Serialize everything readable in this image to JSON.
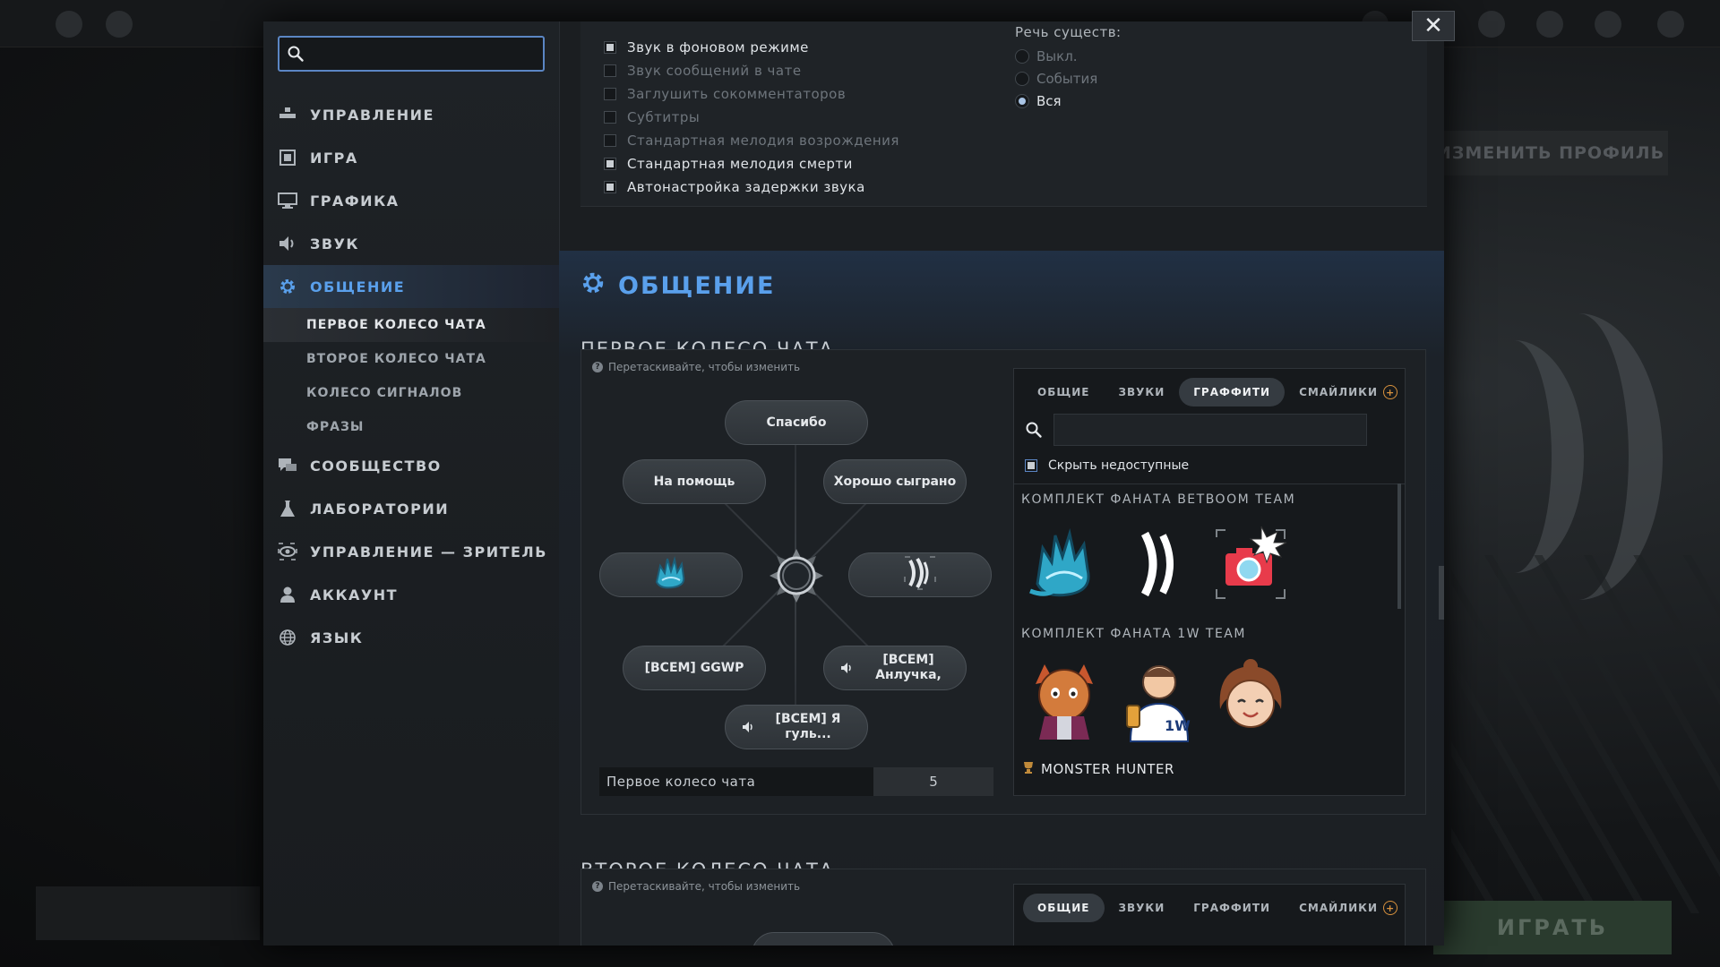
{
  "background": {
    "profile_button": "ИЗМЕНИТЬ ПРОФИЛЬ",
    "play_button": "ИГРАТЬ"
  },
  "window": {
    "close_label": "✕"
  },
  "sidebar": {
    "search": {
      "value": "",
      "placeholder": ""
    },
    "items": [
      {
        "label": "УПРАВЛЕНИЕ",
        "icon": "controls-icon"
      },
      {
        "label": "ИГРА",
        "icon": "game-icon"
      },
      {
        "label": "ГРАФИКА",
        "icon": "monitor-icon"
      },
      {
        "label": "ЗВУК",
        "icon": "speaker-icon"
      },
      {
        "label": "ОБЩЕНИЕ",
        "icon": "gear-icon",
        "active": true
      },
      {
        "label": "СООБЩЕСТВО",
        "icon": "chat-bubbles-icon"
      },
      {
        "label": "ЛАБОРАТОРИИ",
        "icon": "flask-icon"
      },
      {
        "label": "УПРАВЛЕНИЕ — ЗРИТЕЛЬ",
        "icon": "eye-icon"
      },
      {
        "label": "АККАУНТ",
        "icon": "user-icon"
      },
      {
        "label": "ЯЗЫК",
        "icon": "globe-icon"
      }
    ],
    "subitems": [
      {
        "label": "ПЕРВОЕ КОЛЕСО ЧАТА",
        "active": true
      },
      {
        "label": "ВТОРОЕ КОЛЕСО ЧАТА"
      },
      {
        "label": "КОЛЕСО СИГНАЛОВ"
      },
      {
        "label": "ФРАЗЫ"
      }
    ]
  },
  "audio": {
    "checkboxes": [
      {
        "label": "Звук в фоновом режиме",
        "checked": true
      },
      {
        "label": "Звук сообщений в чате",
        "checked": false
      },
      {
        "label": "Заглушить сокомментаторов",
        "checked": false
      },
      {
        "label": "Субтитры",
        "checked": false
      },
      {
        "label": "Стандартная мелодия возрождения",
        "checked": false
      },
      {
        "label": "Стандартная мелодия смерти",
        "checked": true
      },
      {
        "label": "Автонастройка задержки звука",
        "checked": true
      }
    ],
    "creature_speech": {
      "label": "Речь существ:",
      "options": [
        {
          "label": "Выкл.",
          "selected": false
        },
        {
          "label": "События",
          "selected": false
        },
        {
          "label": "Вся",
          "selected": true
        }
      ]
    }
  },
  "section": {
    "title": "ОБЩЕНИЕ",
    "wheel1_title": "ПЕРВОЕ КОЛЕСО ЧАТА",
    "wheel2_title": "ВТОРОЕ КОЛЕСО ЧАТА"
  },
  "wheel1": {
    "hint": "Перетаскивайте, чтобы изменить",
    "top": "Спасибо",
    "upper_left": "На помощь",
    "upper_right": "Хорошо сыграно",
    "left_icon": "blue-hand-graffiti-icon",
    "right_icon": "sound-wave-icon",
    "lower_left": "[ВСЕМ] GGWP",
    "lower_right": "[ВСЕМ] Анлучка,",
    "bottom": "[ВСЕМ] Я гуль...",
    "name": "Первое колесо чата",
    "number": "5"
  },
  "picker": {
    "tabs": [
      {
        "label": "ОБЩИЕ",
        "active": false
      },
      {
        "label": "ЗВУКИ",
        "active": false
      },
      {
        "label": "ГРАФФИТИ",
        "active": true
      },
      {
        "label": "СМАЙЛИКИ",
        "active": false
      }
    ],
    "search": {
      "value": "",
      "placeholder": ""
    },
    "hide_unavailable": {
      "label": "Скрыть недоступные",
      "checked": true
    },
    "groups": [
      {
        "title": "КОМПЛЕКТ ФАНАТА BETBOOM TEAM",
        "stickers": [
          "blue-hand-sticker",
          "sound-wave-sticker",
          "camera-sticker"
        ]
      },
      {
        "title": "КОМПЛЕКТ ФАНАТА 1W TEAM",
        "stickers": [
          "cat-warrior-sticker",
          "1w-player-sticker",
          "smiling-girl-sticker"
        ]
      }
    ],
    "next_group": "MONSTER HUNTER"
  },
  "wheel2": {
    "hint": "Перетаскивайте, чтобы изменить",
    "tabs": [
      {
        "label": "ОБЩИЕ",
        "active": true
      },
      {
        "label": "ЗВУКИ",
        "active": false
      },
      {
        "label": "ГРАФФИТИ",
        "active": false
      },
      {
        "label": "СМАЙЛИКИ",
        "active": false
      }
    ]
  },
  "colors": {
    "accent": "#5aa0ec",
    "panel": "#1d2125",
    "sidebar": "#1e2226",
    "plus_badge": "#d8913d"
  }
}
